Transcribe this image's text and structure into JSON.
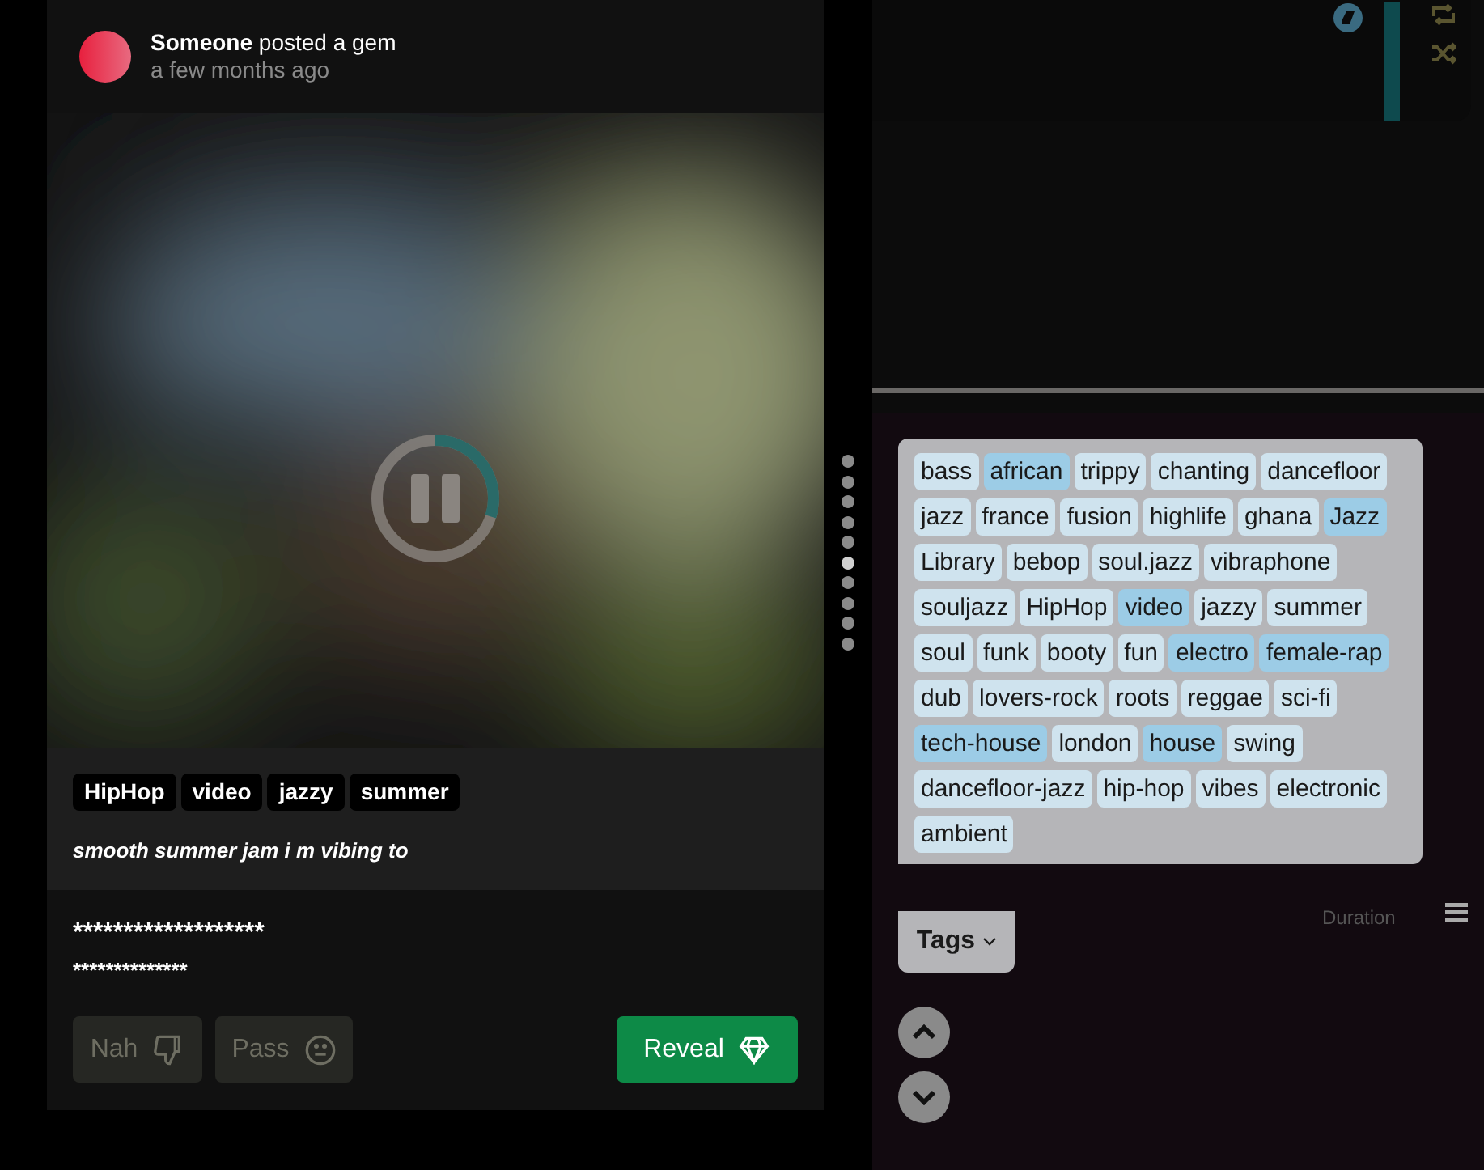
{
  "post": {
    "author": "Someone",
    "action": "posted a gem",
    "time": "a few months ago"
  },
  "video": {
    "playing": true,
    "level": 0.3
  },
  "post_tags": [
    "HipHop",
    "video",
    "jazzy",
    "summer"
  ],
  "caption": "smooth summer jam i m vibing to",
  "hidden_lines": [
    "*******************",
    "**************"
  ],
  "buttons": [
    {
      "label": "Nah",
      "kind": "dislike"
    },
    {
      "label": "Pass",
      "kind": "neutral"
    },
    {
      "label": "Reveal",
      "kind": "reveal"
    }
  ],
  "pager": [
    {
      "selected": false
    },
    {
      "selected": false
    },
    {
      "selected": false
    },
    {
      "selected": false
    },
    {
      "selected": false
    },
    {
      "selected": true
    },
    {
      "selected": false
    },
    {
      "selected": false
    },
    {
      "selected": false
    },
    {
      "selected": false
    }
  ],
  "tag_menu": {
    "label": "Tags",
    "expanded": true,
    "tags": [
      {
        "label": "bass",
        "selected": false
      },
      {
        "label": "african",
        "selected": true
      },
      {
        "label": "trippy",
        "selected": false
      },
      {
        "label": "chanting",
        "selected": false
      },
      {
        "label": "dancefloor",
        "selected": false
      },
      {
        "label": "jazz",
        "selected": false
      },
      {
        "label": "france",
        "selected": false
      },
      {
        "label": "fusion",
        "selected": false
      },
      {
        "label": "highlife",
        "selected": false
      },
      {
        "label": "ghana",
        "selected": false
      },
      {
        "label": "Jazz",
        "selected": true
      },
      {
        "label": "Library",
        "selected": false
      },
      {
        "label": "bebop",
        "selected": false
      },
      {
        "label": "soul.jazz",
        "selected": false
      },
      {
        "label": "vibraphone",
        "selected": false
      },
      {
        "label": "souljazz",
        "selected": false
      },
      {
        "label": "HipHop",
        "selected": false
      },
      {
        "label": "video",
        "selected": true
      },
      {
        "label": "jazzy",
        "selected": false
      },
      {
        "label": "summer",
        "selected": false
      },
      {
        "label": "soul",
        "selected": false
      },
      {
        "label": "funk",
        "selected": false
      },
      {
        "label": "booty",
        "selected": false
      },
      {
        "label": "fun",
        "selected": false
      },
      {
        "label": "electro",
        "selected": true
      },
      {
        "label": "female-rap",
        "selected": true
      },
      {
        "label": "dub",
        "selected": false
      },
      {
        "label": "lovers-rock",
        "selected": false
      },
      {
        "label": "roots",
        "selected": false
      },
      {
        "label": "reggae",
        "selected": false
      },
      {
        "label": "sci-fi",
        "selected": false
      },
      {
        "label": "tech-house",
        "selected": true
      },
      {
        "label": "london",
        "selected": false
      },
      {
        "label": "house",
        "selected": true
      },
      {
        "label": "swing",
        "selected": false
      },
      {
        "label": "dancefloor-jazz",
        "selected": false
      },
      {
        "label": "hip-hop",
        "selected": false
      },
      {
        "label": "vibes",
        "selected": false
      },
      {
        "label": "electronic",
        "selected": false
      },
      {
        "label": "ambient",
        "selected": false
      }
    ]
  },
  "column_header": "Duration"
}
